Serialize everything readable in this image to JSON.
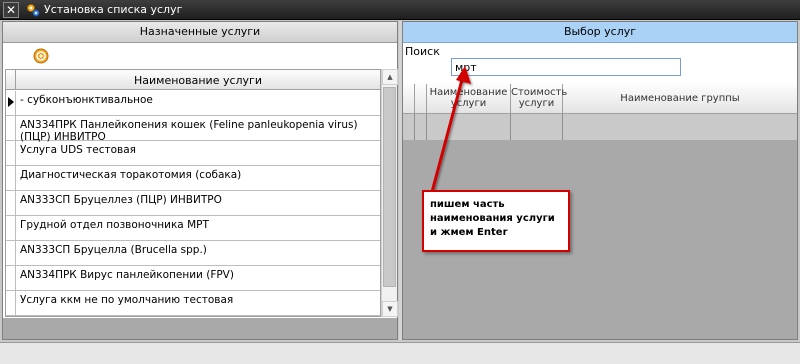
{
  "window": {
    "title": "Установка списка услуг",
    "close_glyph": "✕"
  },
  "left": {
    "header": "Назначенные услуги",
    "column_title": "Наименование услуги",
    "rows": [
      {
        "text": "- субконъюнктивальное",
        "current": true
      },
      {
        "text": "AN334ПРК Панлейкопения кошек (Feline panleukopenia virus) (ПЦР) ИНВИТРО",
        "current": false
      },
      {
        "text": "Услуга UDS тестовая",
        "current": false
      },
      {
        "text": "Диагностическая торакотомия (собака)",
        "current": false
      },
      {
        "text": "AN333СП Бруцеллез (ПЦР) ИНВИТРО",
        "current": false
      },
      {
        "text": "Грудной отдел позвоночника МРТ",
        "current": false
      },
      {
        "text": "AN333СП Бруцелла (Brucella spp.)",
        "current": false
      },
      {
        "text": "AN334ПРК Вирус панлейкопении (FPV)",
        "current": false
      },
      {
        "text": "Услуга ккм не по умолчанию тестовая",
        "current": false
      }
    ]
  },
  "right": {
    "header": "Выбор услуг",
    "search_label": "Поиск",
    "search_value": "мрт",
    "columns": {
      "name": "Наименование услуги",
      "price": "Стоимость услуги",
      "group": "Наименование группы"
    }
  },
  "annotation": {
    "text": "пишем часть наименования услуги и жмем Enter",
    "color": "#d20000"
  },
  "colors": {
    "right_header": "#a9d2f6",
    "titlebar": "#2a2a2a"
  }
}
